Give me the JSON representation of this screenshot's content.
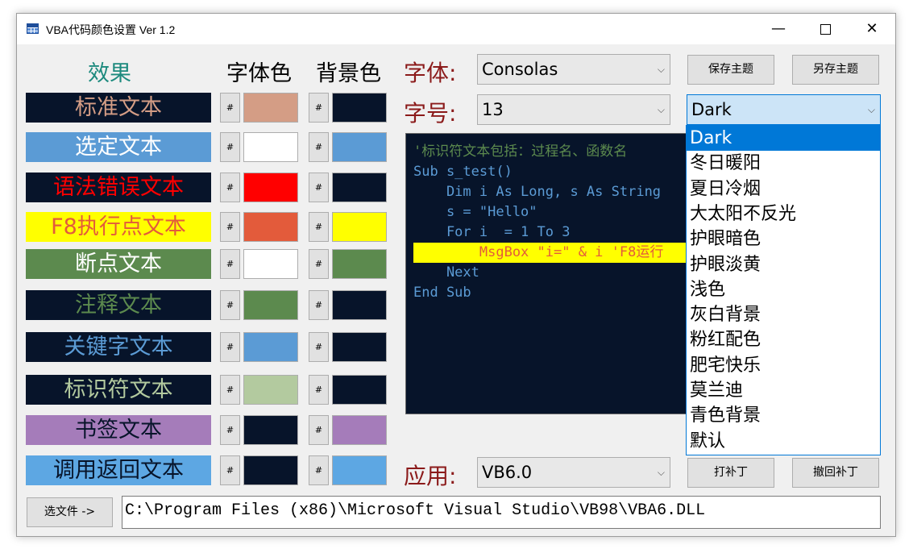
{
  "window": {
    "title": "VBA代码颜色设置 Ver 1.2",
    "min_label": "—",
    "close_label": "✕"
  },
  "headers": {
    "effect": "效果",
    "font_color": "字体色",
    "bg_color": "背景色"
  },
  "hash_label": "#",
  "rows": [
    {
      "text": "标准文本",
      "fg": "#d49d85",
      "bg": "#07142a"
    },
    {
      "text": "选定文本",
      "fg": "#ffffff",
      "bg": "#5b9bd5"
    },
    {
      "text": "语法错误文本",
      "fg": "#ff0000",
      "bg": "#07142a"
    },
    {
      "text": "F8执行点文本",
      "fg": "#e35b3b",
      "bg": "#ffff00"
    },
    {
      "text": "断点文本",
      "fg": "#ffffff",
      "bg": "#5c8a4e"
    },
    {
      "text": "注释文本",
      "fg": "#5c8a4e",
      "bg": "#07142a"
    },
    {
      "text": "关键字文本",
      "fg": "#5b9bd5",
      "bg": "#07142a"
    },
    {
      "text": "标识符文本",
      "fg": "#b3ca9f",
      "bg": "#07142a"
    },
    {
      "text": "书签文本",
      "fg": "#07142a",
      "bg": "#a57cba"
    },
    {
      "text": "调用返回文本",
      "fg": "#07142a",
      "bg": "#5da7e3"
    }
  ],
  "font": {
    "label": "字体:",
    "value": "Consolas"
  },
  "size": {
    "label": "字号:",
    "value": "13"
  },
  "app": {
    "label": "应用:",
    "value": "VB6.0"
  },
  "buttons": {
    "save_theme": "保存主题",
    "save_as_theme": "另存主题",
    "patch": "打补丁",
    "unpatch": "撤回补丁",
    "select_file": "选文件 ->"
  },
  "theme": {
    "value": "Dark",
    "options": [
      "Dark",
      "冬日暖阳",
      "夏日冷烟",
      "大太阳不反光",
      "护眼暗色",
      "护眼淡黄",
      "浅色",
      "灰白背景",
      "粉红配色",
      "肥宅快乐",
      "莫兰迪",
      "青色背景",
      "默认"
    ]
  },
  "code_preview": {
    "lines": [
      {
        "text": "'标识符文本包括：过程名、函数名",
        "color": "#5c8a4e"
      },
      {
        "text": "Sub s_test()",
        "color": "#5b9bd5"
      },
      {
        "text": "    Dim i As Long, s As String",
        "color": "#5b9bd5"
      },
      {
        "text": "    s = \"Hello\"",
        "color": "#5b9bd5"
      },
      {
        "text": "    For i  = 1 To 3",
        "color": "#5b9bd5"
      },
      {
        "text": "        MsgBox \"i=\" & i 'F8运行",
        "color": "#e35b3b"
      },
      {
        "text": "    Next",
        "color": "#5b9bd5"
      },
      {
        "text": "End Sub",
        "color": "#5b9bd5"
      }
    ]
  },
  "file_path": "C:\\Program Files (x86)\\Microsoft Visual Studio\\VB98\\VBA6.DLL"
}
